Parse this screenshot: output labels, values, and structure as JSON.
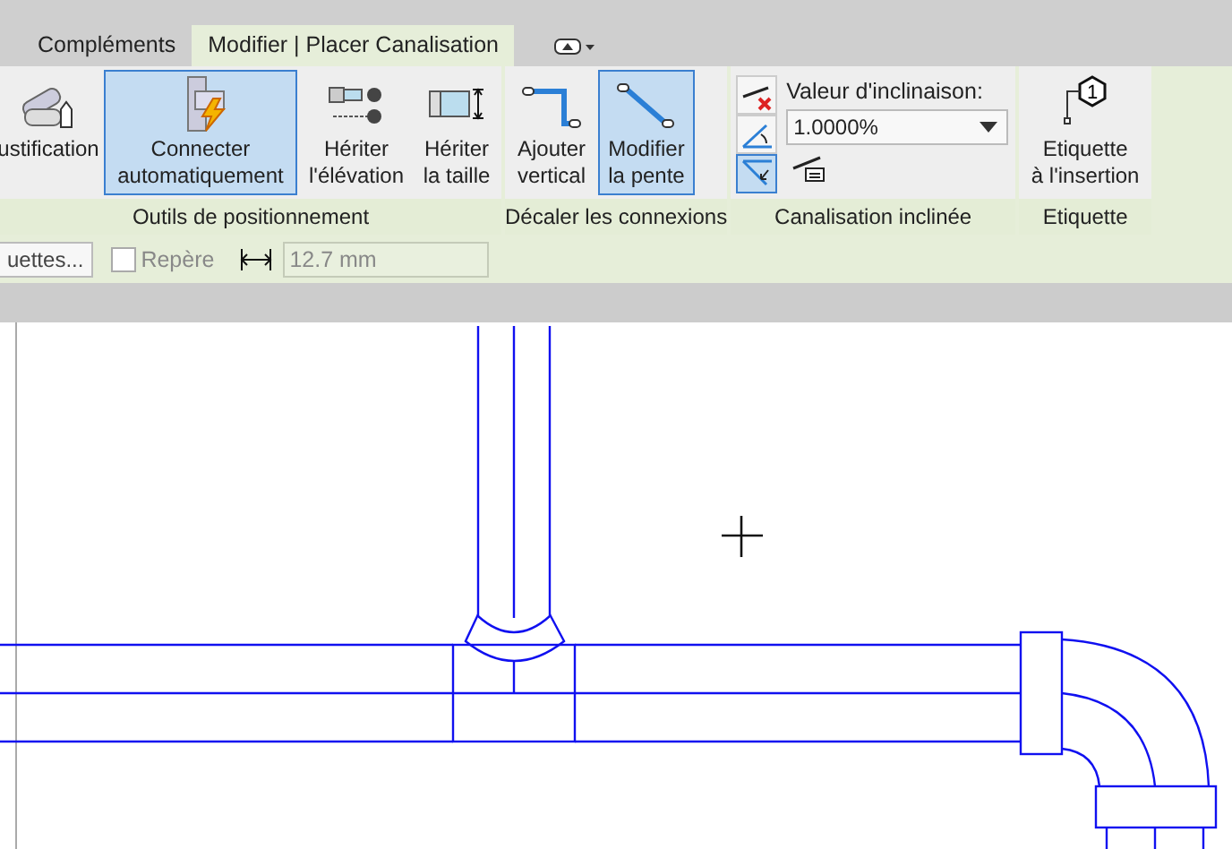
{
  "tabs": [
    {
      "label": "Compléments",
      "selected": false
    },
    {
      "label": "Modifier | Placer Canalisation",
      "selected": true
    }
  ],
  "ribbon": {
    "panels": [
      {
        "kind": "buttons",
        "label": "Outils de positionnement",
        "buttons": [
          {
            "label": "ustification",
            "selected": false
          },
          {
            "label": "Connecter\nautomatiquement",
            "selected": true
          },
          {
            "label": "Hériter\nl'élévation",
            "selected": false
          },
          {
            "label": "Hériter\nla taille",
            "selected": false
          }
        ]
      },
      {
        "kind": "buttons",
        "label": "Décaler les connexions",
        "buttons": [
          {
            "label": "Ajouter\nvertical",
            "selected": false
          },
          {
            "label": "Modifier\nla pente",
            "selected": true
          }
        ]
      },
      {
        "kind": "slope",
        "label": "Canalisation inclinée",
        "tools": [
          {
            "selected": false
          },
          {
            "selected": false
          },
          {
            "selected": true
          }
        ],
        "field_label": "Valeur d'inclinaison:",
        "value": "1.0000%"
      },
      {
        "kind": "buttons",
        "label": "Etiquette",
        "buttons": [
          {
            "label": "Etiquette\nà l'insertion",
            "selected": false,
            "icon_text": "1"
          }
        ]
      }
    ]
  },
  "options_bar": {
    "button": "uettes...",
    "checkbox": {
      "label": "Repère",
      "checked": false
    },
    "width_field": {
      "value": "12.7 mm"
    }
  }
}
